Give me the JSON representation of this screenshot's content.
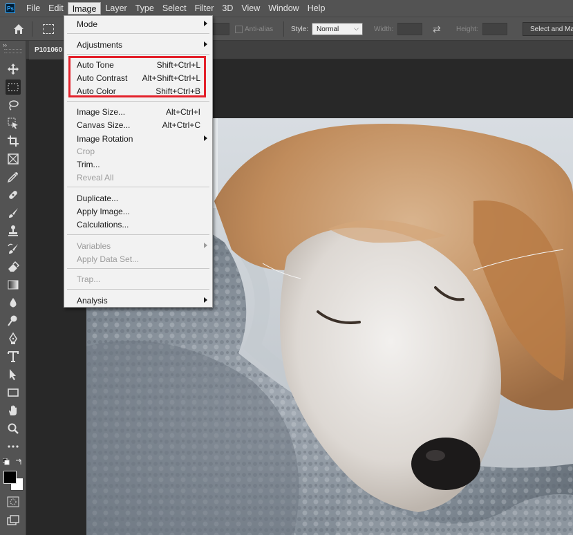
{
  "app": {
    "logo_text": "Ps"
  },
  "menubar": {
    "items": [
      {
        "label": "File"
      },
      {
        "label": "Edit"
      },
      {
        "label": "Image"
      },
      {
        "label": "Layer"
      },
      {
        "label": "Type"
      },
      {
        "label": "Select"
      },
      {
        "label": "Filter"
      },
      {
        "label": "3D"
      },
      {
        "label": "View"
      },
      {
        "label": "Window"
      },
      {
        "label": "Help"
      }
    ]
  },
  "options_bar": {
    "anti_alias_label": "Anti-alias",
    "style_label": "Style:",
    "style_value": "Normal",
    "width_label": "Width:",
    "height_label": "Height:",
    "select_mask_button": "Select and Ma"
  },
  "document": {
    "tab_title": "P101060"
  },
  "image_menu": {
    "items": [
      {
        "label": "Mode",
        "shortcut": "",
        "submenu": true,
        "enabled": true
      },
      {
        "label": "Adjustments",
        "shortcut": "",
        "submenu": true,
        "enabled": true
      },
      {
        "label": "Auto Tone",
        "shortcut": "Shift+Ctrl+L",
        "submenu": false,
        "enabled": true
      },
      {
        "label": "Auto Contrast",
        "shortcut": "Alt+Shift+Ctrl+L",
        "submenu": false,
        "enabled": true
      },
      {
        "label": "Auto Color",
        "shortcut": "Shift+Ctrl+B",
        "submenu": false,
        "enabled": true
      },
      {
        "label": "Image Size...",
        "shortcut": "Alt+Ctrl+I",
        "submenu": false,
        "enabled": true
      },
      {
        "label": "Canvas Size...",
        "shortcut": "Alt+Ctrl+C",
        "submenu": false,
        "enabled": true
      },
      {
        "label": "Image Rotation",
        "shortcut": "",
        "submenu": true,
        "enabled": true
      },
      {
        "label": "Crop",
        "shortcut": "",
        "submenu": false,
        "enabled": false
      },
      {
        "label": "Trim...",
        "shortcut": "",
        "submenu": false,
        "enabled": true
      },
      {
        "label": "Reveal All",
        "shortcut": "",
        "submenu": false,
        "enabled": false
      },
      {
        "label": "Duplicate...",
        "shortcut": "",
        "submenu": false,
        "enabled": true
      },
      {
        "label": "Apply Image...",
        "shortcut": "",
        "submenu": false,
        "enabled": true
      },
      {
        "label": "Calculations...",
        "shortcut": "",
        "submenu": false,
        "enabled": true
      },
      {
        "label": "Variables",
        "shortcut": "",
        "submenu": true,
        "enabled": false
      },
      {
        "label": "Apply Data Set...",
        "shortcut": "",
        "submenu": false,
        "enabled": false
      },
      {
        "label": "Trap...",
        "shortcut": "",
        "submenu": false,
        "enabled": false
      },
      {
        "label": "Analysis",
        "shortcut": "",
        "submenu": true,
        "enabled": true
      }
    ],
    "highlight_color": "#e3202a"
  },
  "toolbar": {
    "tools": [
      "move-icon",
      "rectangular-marquee-icon",
      "lasso-icon",
      "object-select-icon",
      "crop-icon",
      "frame-icon",
      "eyedropper-icon",
      "healing-brush-icon",
      "brush-icon",
      "clone-stamp-icon",
      "history-brush-icon",
      "eraser-icon",
      "gradient-icon",
      "blur-icon",
      "dodge-icon",
      "pen-icon",
      "type-icon",
      "path-select-icon",
      "rectangle-icon",
      "hand-icon",
      "zoom-icon",
      "more-tools-icon"
    ],
    "foreground_color": "#000000",
    "background_color": "#ffffff"
  },
  "colors": {
    "chrome": "#535353",
    "workspace": "#282828",
    "menu_bg": "#f2f2f2"
  }
}
